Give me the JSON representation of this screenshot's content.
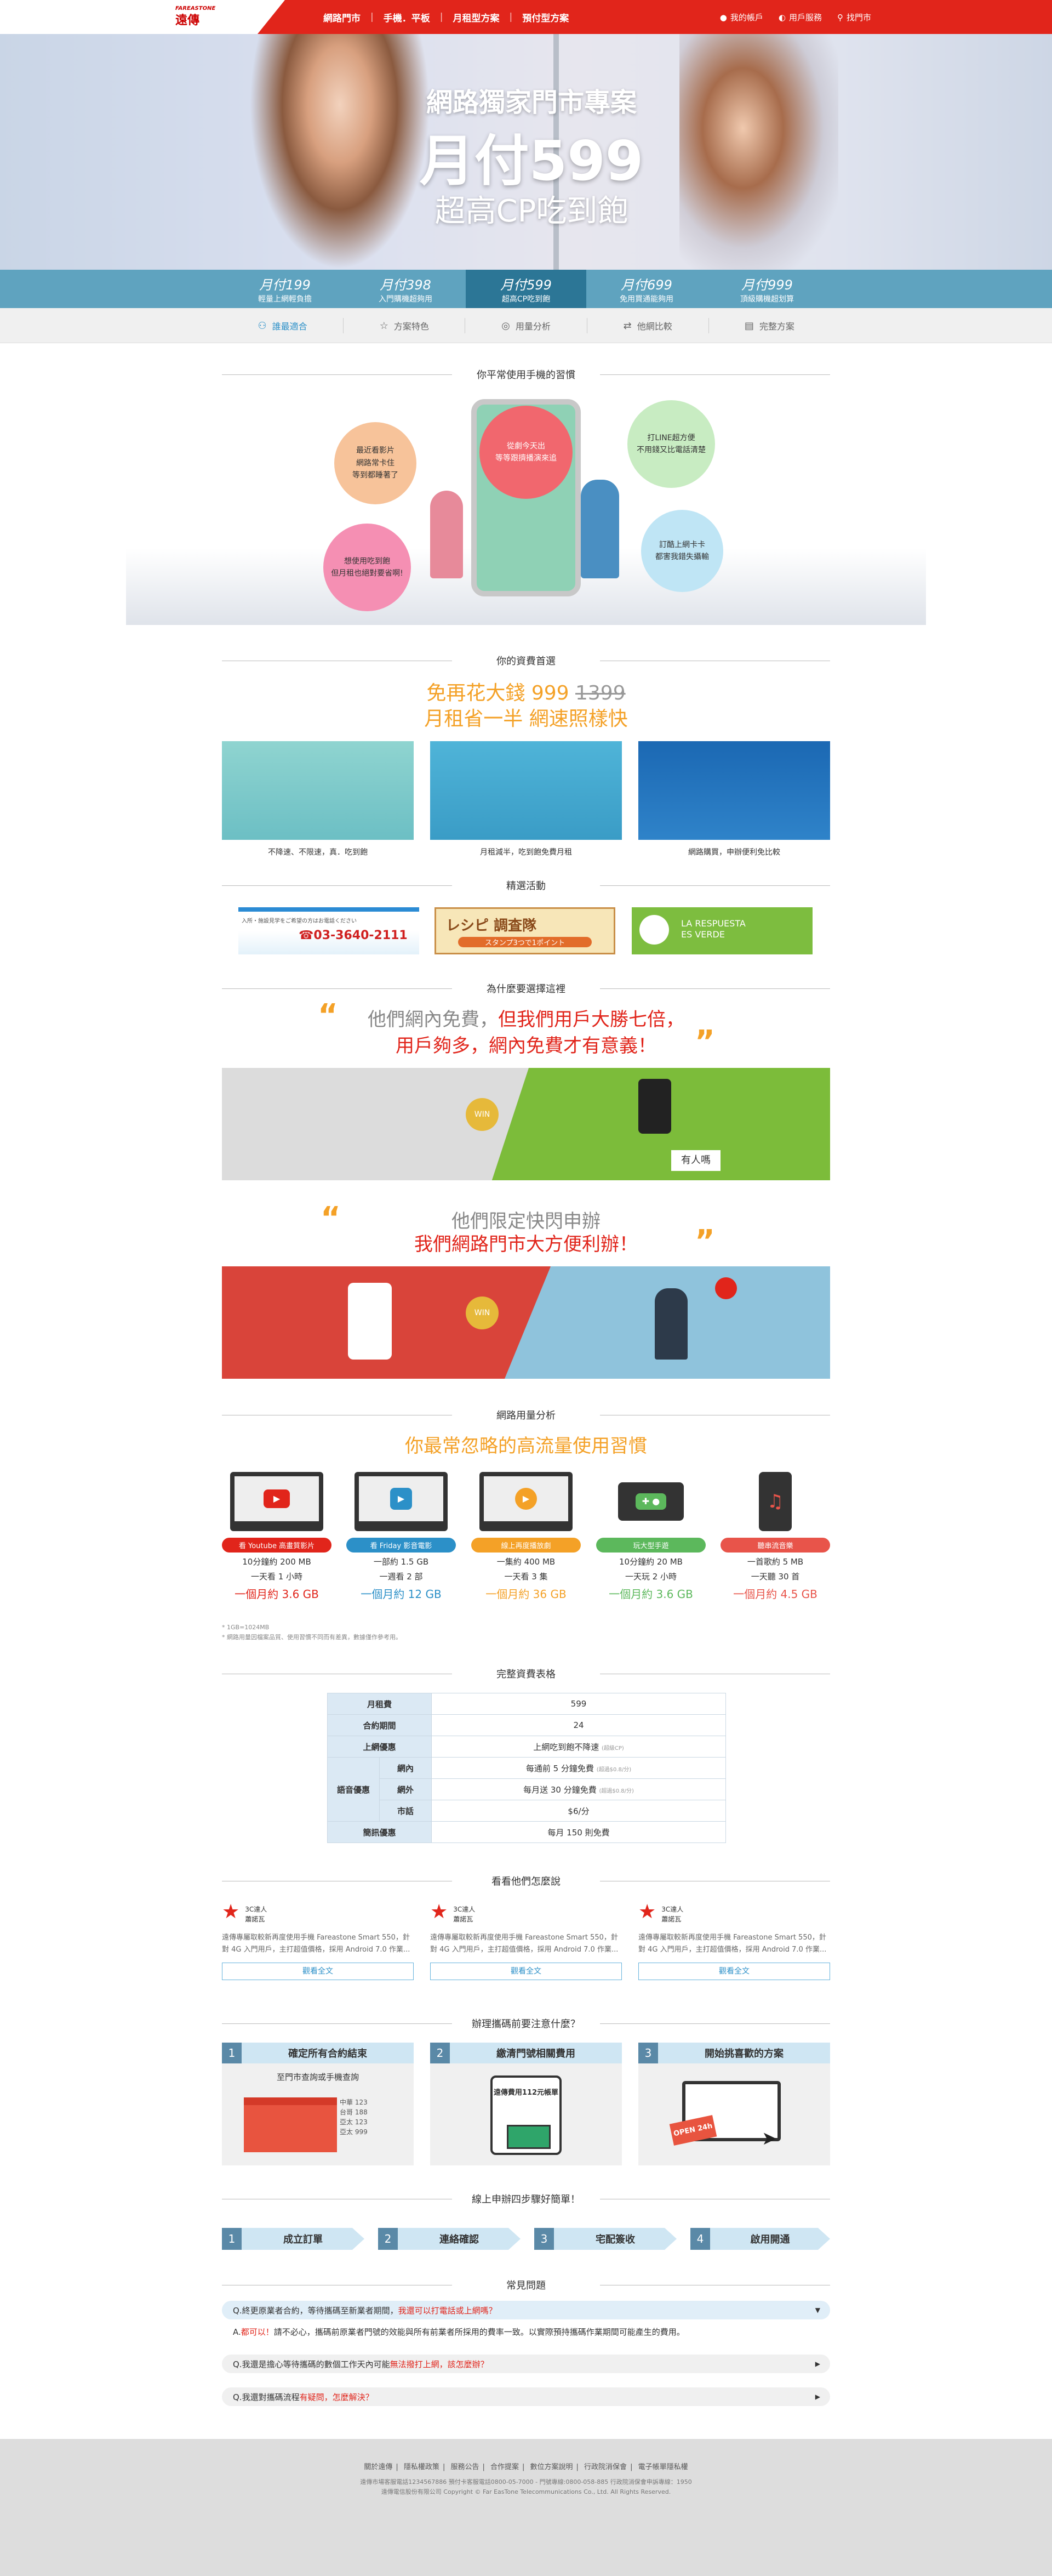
{
  "header": {
    "logo_small": "FAREASTONE",
    "logo_main": "遠傳",
    "nav": [
      "網路門市",
      "手機．平板",
      "月租型方案",
      "預付型方案"
    ],
    "user_links": [
      {
        "icon": "user-icon",
        "label": "我的帳戶"
      },
      {
        "icon": "service-icon",
        "label": "用戶服務"
      },
      {
        "icon": "search-icon",
        "label": "找門市"
      }
    ]
  },
  "hero": {
    "line1": "網路獨家門市專案",
    "line2": "月付599",
    "line3": "超高CP吃到飽"
  },
  "plan_tabs": [
    {
      "price": "月付199",
      "desc": "輕量上網輕負擔"
    },
    {
      "price": "月付398",
      "desc": "入門購機超夠用"
    },
    {
      "price": "月付599",
      "desc": "超高CP吃到飽"
    },
    {
      "price": "月付699",
      "desc": "免用買通能夠用"
    },
    {
      "price": "月付999",
      "desc": "頂級購機超划算"
    }
  ],
  "sub_tabs": [
    {
      "icon": "fit-icon",
      "label": "誰最適合"
    },
    {
      "icon": "star-icon",
      "label": "方案特色"
    },
    {
      "icon": "analysis-icon",
      "label": "用量分析"
    },
    {
      "icon": "compare-icon",
      "label": "他網比較"
    },
    {
      "icon": "doc-icon",
      "label": "完整方案"
    }
  ],
  "habits": {
    "title": "你平常使用手機的習慣",
    "bubbles": [
      "最近看影片\n網路常卡住\n等到都睡著了",
      "想使用吃到飽\n但月租也絕對要省啊!",
      "從劇今天出\n等等跟擠播演來追",
      "打LINE超方便\n不用錢又比電話清楚",
      "訂酷上網卡卡\n都害我錯失攝輸"
    ]
  },
  "budget": {
    "title": "你的資費首選",
    "line1_a": "免再花大錢",
    "line1_b": "999",
    "line1_c": "1399",
    "line2": "月租省一半 網速照樣快",
    "cards": [
      "不降速、不限速，真．吃到飽",
      "月租減半，吃到飽免費月租",
      "網路購買，申辦便利免比較"
    ]
  },
  "events": {
    "title": "精選活動",
    "banners": [
      {
        "text": "入所・施設見学をご希望の方はお電話ください",
        "phone": "☎03-3640-2111"
      },
      {
        "text": "レシピ 調査隊",
        "sub": "スタンプ3つで1ポイント"
      },
      {
        "text": "LA RESPUESTA ES VERDE"
      }
    ]
  },
  "why": {
    "title": "為什麼要選擇這裡",
    "quote1_a": "他們網內免費，",
    "quote1_b": "但我們用戶大勝七倍，",
    "quote1_c": "用戶夠多，網內免費才有意義！",
    "medal": "WIN",
    "sign": "有人嗎",
    "quote2_a": "他們限定快閃申辦",
    "quote2_b": "我們網路門市大方便利辦！"
  },
  "usage": {
    "title": "網路用量分析",
    "headline": "你最常忽略的高流量使用習慣",
    "items": [
      {
        "icon": "youtube-icon",
        "pill": "看 Youtube 高畫質影片",
        "color": "#e1251b",
        "l1": "10分鐘約 200 MB",
        "l2": "一天看 1 小時",
        "month": "一個月約 3.6 GB"
      },
      {
        "icon": "play-icon",
        "pill": "看 Friday 影音電影",
        "color": "#2c90c8",
        "l1": "一部約 1.5 GB",
        "l2": "一週看 2 部",
        "month": "一個月約 12 GB"
      },
      {
        "icon": "playback-icon",
        "pill": "線上再度播放劇",
        "color": "#f4a127",
        "l1": "一集約 400 MB",
        "l2": "一天看 3 集",
        "month": "一個月約 36 GB"
      },
      {
        "icon": "gamepad-icon",
        "pill": "玩大型手遊",
        "color": "#5cb85c",
        "l1": "10分鐘約 20 MB",
        "l2": "一天玩 2 小時",
        "month": "一個月約 3.6 GB"
      },
      {
        "icon": "music-icon",
        "pill": "聽串流音樂",
        "color": "#e8544a",
        "l1": "一首歌約 5 MB",
        "l2": "一天聽 30 首",
        "month": "一個月約 4.5 GB"
      }
    ],
    "note1": "* 1GB=1024MB",
    "note2": "* 網路用量因檔案品質、使用習慣不同而有差異，數據僅作參考用。"
  },
  "table": {
    "title": "完整資費表格",
    "rows": {
      "fee_label": "月租費",
      "fee": "599",
      "term_label": "合約期間",
      "term": "24",
      "data_label": "上網優惠",
      "data": "上網吃到飽不降速",
      "data_note": "(超級CP)",
      "voice_label": "語音優惠",
      "in_label": "網內",
      "in": "每通前 5 分鐘免費",
      "in_note": "(超過$0.8/分)",
      "out_label": "網外",
      "out": "每月送 30 分鐘免費",
      "out_note": "(超過$0.8/分)",
      "local_label": "市話",
      "local": "$6/分",
      "sms_label": "簡訊優惠",
      "sms": "每月 150 則免費"
    }
  },
  "reviews": {
    "title": "看看他們怎麼說",
    "items": [
      {
        "tag": "3C達人",
        "name": "蕭諾瓦",
        "text": "遠傳專屬取較新再度使用手機 Fareastone Smart 550，針對 4G 入門用戶，主打超值價格，採用 Android 7.0 作業..."
      },
      {
        "tag": "3C達人",
        "name": "蕭諾瓦",
        "text": "遠傳專屬取較新再度使用手機 Fareastone Smart 550，針對 4G 入門用戶，主打超值價格，採用 Android 7.0 作業..."
      },
      {
        "tag": "3C達人",
        "name": "蕭諾瓦",
        "text": "遠傳專屬取較新再度使用手機 Fareastone Smart 550，針對 4G 入門用戶，主打超值價格，採用 Android 7.0 作業..."
      }
    ],
    "button": "觀看全文"
  },
  "notice": {
    "title": "辦理攜碼前要注意什麼？",
    "cards": [
      {
        "n": "1",
        "t": "確定所有合約結束",
        "sub": "至門市查詢或手機查詢",
        "list": [
          "中華 123",
          "台哥 188",
          "亞太 123",
          "亞太 999"
        ]
      },
      {
        "n": "2",
        "t": "繳清門號相關費用",
        "sub": "遠傳費用112元帳單"
      },
      {
        "n": "3",
        "t": "開始挑喜歡的方案",
        "sub": "OPEN 24h"
      }
    ]
  },
  "steps": {
    "title": "線上申辦四步驟好簡單！",
    "items": [
      {
        "n": "1",
        "t": "成立訂單"
      },
      {
        "n": "2",
        "t": "連絡確認"
      },
      {
        "n": "3",
        "t": "宅配簽收"
      },
      {
        "n": "4",
        "t": "啟用開通"
      }
    ]
  },
  "faq": {
    "title": "常見問題",
    "items": [
      {
        "q_a": "Q.終更原業者合約，等待攜碼至新業者期間，",
        "q_b": "我還可以打電話或上網嗎？",
        "open": true
      },
      {
        "q_a": "Q.我還是擔心等待攜碼的數個工作天內可能",
        "q_b": "無法撥打上網，該怎麼辦？",
        "open": false
      },
      {
        "q_a": "Q.我還對攜碼流程",
        "q_b": "有疑問，怎麼解決？",
        "open": false
      }
    ],
    "answer_a": "A.",
    "answer_b": "都可以！",
    "answer_c": "請不必心，攜碼前原業者門號的效能與所有前業者所採用的費率一致。以實際預持攜碼作業期間可能產生的費用。"
  },
  "footer": {
    "links": [
      "關於遠傳",
      "隱私權政策",
      "服務公告",
      "合作提案",
      "數位方案說明",
      "行政院消保會",
      "電子帳單隱私權"
    ],
    "line1": "遠傳市場客服電話1234567886 預付卡客服電話0800-05-7000 - 門號專線:0800-058-885 行政院消保會申訴專線：1950",
    "line2": "遠傳電信股份有限公司 Copyright © Far EasTone Telecommunications Co., Ltd. All Rights Reserved."
  }
}
